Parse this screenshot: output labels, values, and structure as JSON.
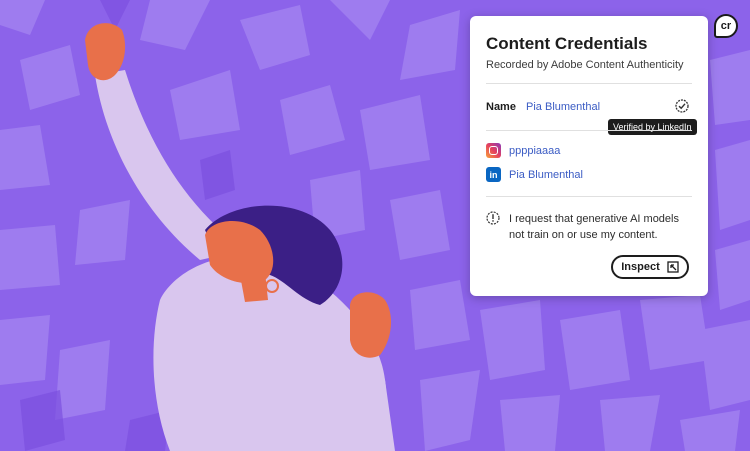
{
  "card": {
    "title": "Content Credentials",
    "subtitle": "Recorded by Adobe Content Authenticity",
    "name_label": "Name",
    "name_value": "Pia Blumenthal",
    "tooltip": "Verified by LinkedIn",
    "instagram_handle": "ppppiaaaa",
    "linkedin_name": "Pia Blumenthal",
    "ai_statement": "I request that generative AI models not train on or use my content.",
    "inspect_label": "Inspect"
  },
  "badge": {
    "label": "cr"
  },
  "colors": {
    "background": "#8c63ea",
    "accent_link": "#3b5cc4",
    "skin": "#e8704a",
    "hair": "#3b1f86",
    "shirt": "#d9c6ee"
  },
  "icons": {
    "verified": "verified-check-icon",
    "instagram": "instagram-icon",
    "linkedin": "linkedin-icon",
    "ai": "ai-restriction-icon",
    "inspect": "open-external-icon"
  }
}
